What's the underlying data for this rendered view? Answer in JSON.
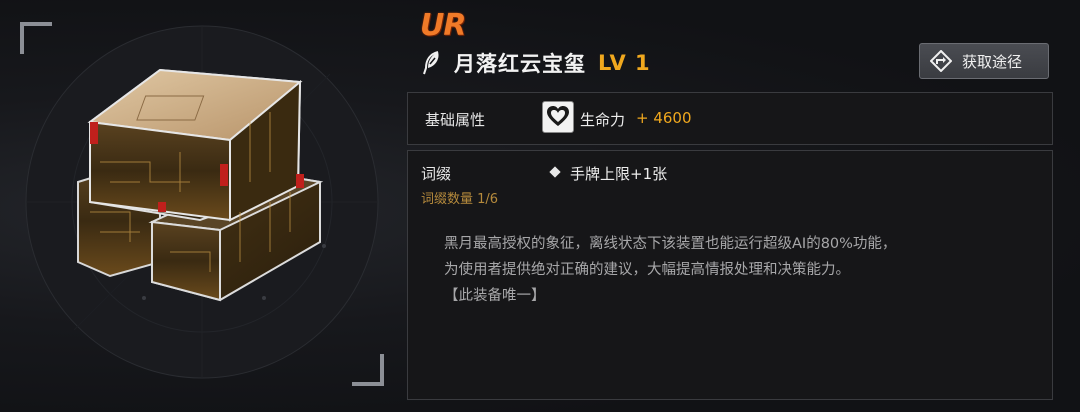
{
  "item": {
    "rarity": "UR",
    "name": "月落红云宝玺",
    "level": "LV 1",
    "image_icon": "cube-device-illustration",
    "name_icon": "feather-icon"
  },
  "header": {
    "obtain_button_label": "获取途径",
    "obtain_icon": "direction-sign-icon"
  },
  "attributes": {
    "section_label": "基础属性",
    "stat_icon": "heart-icon",
    "stat_name": "生命力",
    "stat_value": "+ 4600"
  },
  "affix": {
    "section_label": "词缀",
    "count_label": "词缀数量",
    "count_value": "1/6",
    "entries": [
      "手牌上限+1张"
    ]
  },
  "description": {
    "lines": [
      "黑月最高授权的象征，离线状态下该装置也能运行超级AI的80%功能，",
      "为使用者提供绝对正确的建议，大幅提高情报处理和决策能力。",
      "【此装备唯一】"
    ]
  },
  "colors": {
    "rarity": "#f07a28",
    "level": "#f0a81e",
    "stat_value": "#f0a81e",
    "affix_count": "#b58a3c",
    "background": "#121316",
    "panel": "#161618"
  }
}
